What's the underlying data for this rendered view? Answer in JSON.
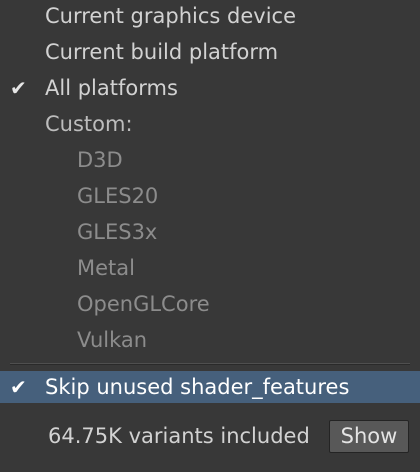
{
  "menu": {
    "items": [
      {
        "label": "Current graphics device",
        "checked": false
      },
      {
        "label": "Current build platform",
        "checked": false
      },
      {
        "label": "All platforms",
        "checked": true
      },
      {
        "label": "Custom:",
        "checked": false
      }
    ],
    "custom_platforms": [
      "D3D",
      "GLES20",
      "GLES3x",
      "Metal",
      "OpenGLCore",
      "Vulkan"
    ],
    "skip_unused": {
      "label": "Skip unused shader_features",
      "checked": true
    },
    "check_glyph": "✔"
  },
  "footer": {
    "variants_text": "64.75K variants included",
    "show_label": "Show"
  },
  "colors": {
    "background": "#383838",
    "selection": "#46607c",
    "text": "#d2d2d2",
    "disabled_text": "#8c8c8c"
  }
}
